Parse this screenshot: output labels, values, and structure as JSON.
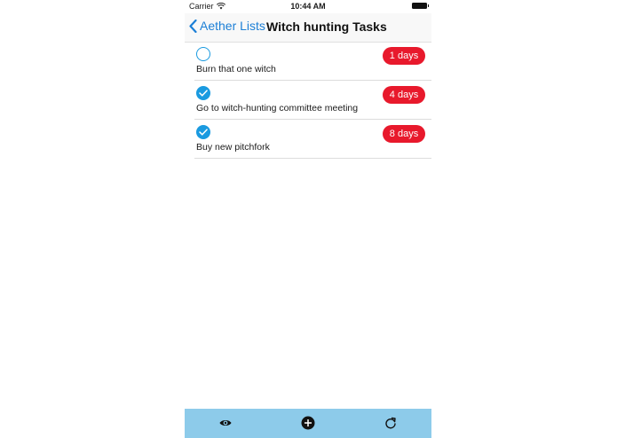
{
  "status_bar": {
    "carrier": "Carrier",
    "time": "10:44 AM"
  },
  "nav": {
    "back_label": "Aether Lists",
    "title": "Witch hunting Tasks"
  },
  "tasks": [
    {
      "text": "Burn that one witch",
      "badge": "1 days",
      "completed": false
    },
    {
      "text": "Go to witch-hunting committee meeting",
      "badge": "4 days",
      "completed": true
    },
    {
      "text": "Buy new pitchfork",
      "badge": "8 days",
      "completed": true
    }
  ],
  "toolbar": {
    "icons": [
      "eye-icon",
      "add-circle-icon",
      "refresh-icon"
    ]
  },
  "colors": {
    "accent": "#1a9ae0",
    "badge": "#e8192c",
    "toolbar": "#8dcbea",
    "link": "#1c7fd6"
  }
}
